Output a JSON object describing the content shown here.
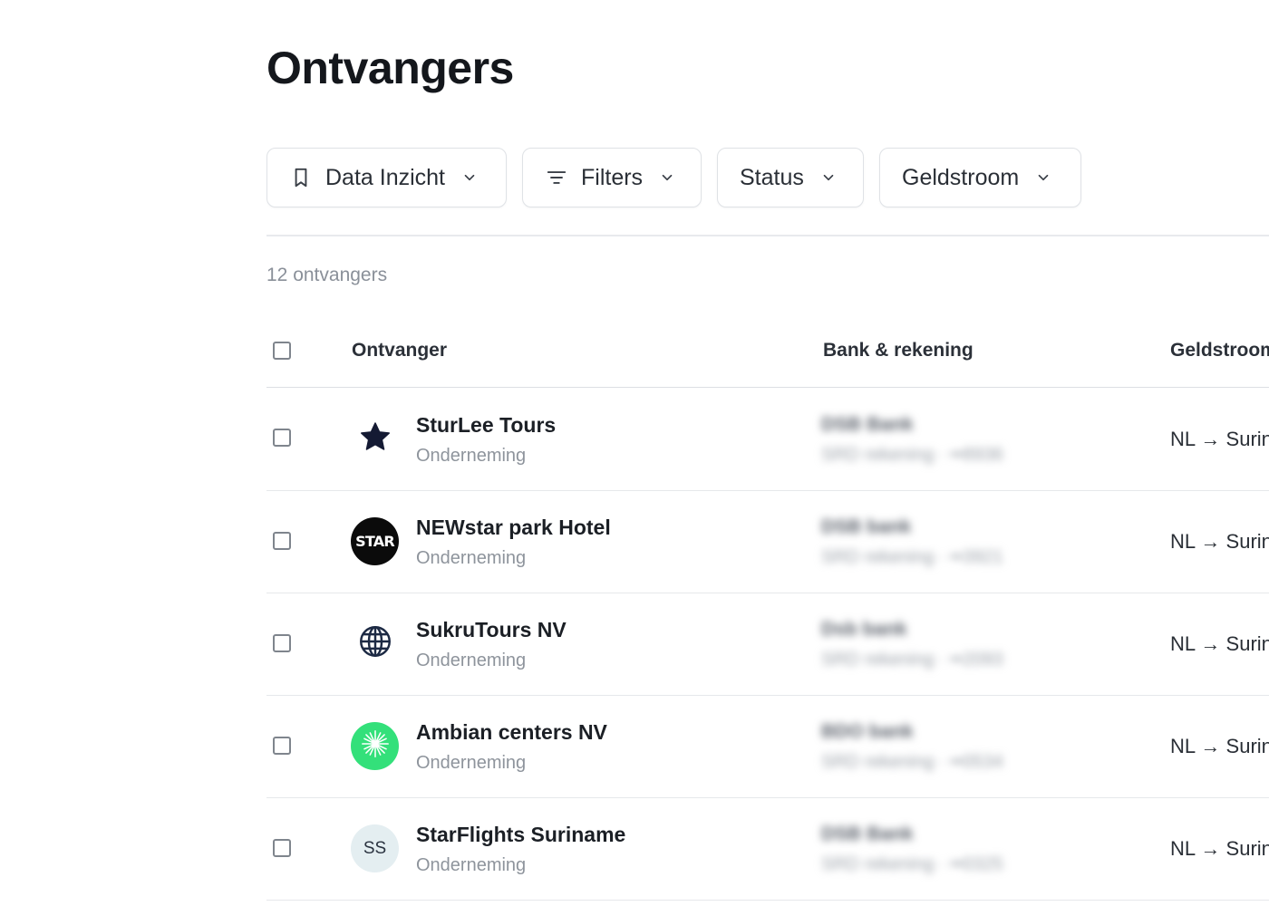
{
  "page": {
    "title": "Ontvangers"
  },
  "toolbar": {
    "data_inzicht": "Data Inzicht",
    "filters": "Filters",
    "status": "Status",
    "geldstroom": "Geldstroom"
  },
  "summary": {
    "count": "12 ontvangers"
  },
  "table": {
    "headers": {
      "ontvanger": "Ontvanger",
      "bank": "Bank & rekening",
      "geldstroom": "Geldstroom"
    },
    "rows": [
      {
        "name": "SturLee Tours",
        "type": "Onderneming",
        "avatar": {
          "kind": "star-icon"
        },
        "bank": "DSB Bank",
        "account": "SRD rekening · ••8936",
        "flow": "NL → Suriname"
      },
      {
        "name": "NEWstar park Hotel",
        "type": "Onderneming",
        "avatar": {
          "kind": "logo",
          "text": "STAR",
          "color": "#0b0b0b"
        },
        "bank": "DSB bank",
        "account": "SRD rekening · ••3921",
        "flow": "NL → Suriname"
      },
      {
        "name": "SukruTours NV",
        "type": "Onderneming",
        "avatar": {
          "kind": "globe-icon"
        },
        "bank": "Dsb bank",
        "account": "SRD rekening · ••2093",
        "flow": "NL → Suriname"
      },
      {
        "name": "Ambian centers NV",
        "type": "Onderneming",
        "avatar": {
          "kind": "sparkle-icon",
          "color": "#33e07a"
        },
        "bank": "BDO bank",
        "account": "SRD rekening · ••0534",
        "flow": "NL → Suriname"
      },
      {
        "name": "StarFlights Suriname",
        "type": "Onderneming",
        "avatar": {
          "kind": "initials",
          "text": "SS",
          "color": "#e4eef1"
        },
        "bank": "DSB Bank",
        "account": "SRD rekening · ••0325",
        "flow": "NL → Suriname"
      }
    ]
  },
  "colors": {
    "text": "#111418",
    "muted": "#8e949c",
    "border": "#dfe2e6",
    "accent_green": "#33e07a"
  }
}
